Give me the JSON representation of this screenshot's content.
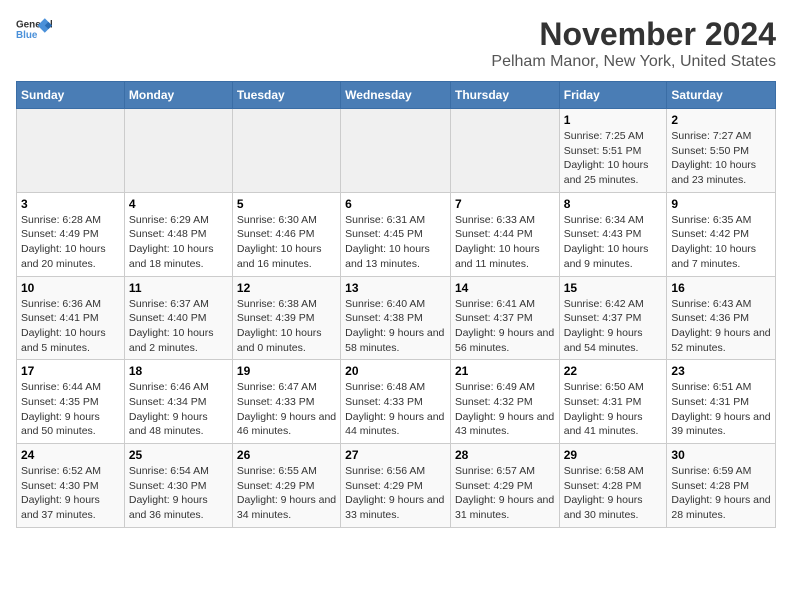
{
  "logo": {
    "line1": "General",
    "line2": "Blue"
  },
  "title": "November 2024",
  "subtitle": "Pelham Manor, New York, United States",
  "days_of_week": [
    "Sunday",
    "Monday",
    "Tuesday",
    "Wednesday",
    "Thursday",
    "Friday",
    "Saturday"
  ],
  "weeks": [
    [
      {
        "day": "",
        "info": ""
      },
      {
        "day": "",
        "info": ""
      },
      {
        "day": "",
        "info": ""
      },
      {
        "day": "",
        "info": ""
      },
      {
        "day": "",
        "info": ""
      },
      {
        "day": "1",
        "info": "Sunrise: 7:25 AM\nSunset: 5:51 PM\nDaylight: 10 hours and 25 minutes."
      },
      {
        "day": "2",
        "info": "Sunrise: 7:27 AM\nSunset: 5:50 PM\nDaylight: 10 hours and 23 minutes."
      }
    ],
    [
      {
        "day": "3",
        "info": "Sunrise: 6:28 AM\nSunset: 4:49 PM\nDaylight: 10 hours and 20 minutes."
      },
      {
        "day": "4",
        "info": "Sunrise: 6:29 AM\nSunset: 4:48 PM\nDaylight: 10 hours and 18 minutes."
      },
      {
        "day": "5",
        "info": "Sunrise: 6:30 AM\nSunset: 4:46 PM\nDaylight: 10 hours and 16 minutes."
      },
      {
        "day": "6",
        "info": "Sunrise: 6:31 AM\nSunset: 4:45 PM\nDaylight: 10 hours and 13 minutes."
      },
      {
        "day": "7",
        "info": "Sunrise: 6:33 AM\nSunset: 4:44 PM\nDaylight: 10 hours and 11 minutes."
      },
      {
        "day": "8",
        "info": "Sunrise: 6:34 AM\nSunset: 4:43 PM\nDaylight: 10 hours and 9 minutes."
      },
      {
        "day": "9",
        "info": "Sunrise: 6:35 AM\nSunset: 4:42 PM\nDaylight: 10 hours and 7 minutes."
      }
    ],
    [
      {
        "day": "10",
        "info": "Sunrise: 6:36 AM\nSunset: 4:41 PM\nDaylight: 10 hours and 5 minutes."
      },
      {
        "day": "11",
        "info": "Sunrise: 6:37 AM\nSunset: 4:40 PM\nDaylight: 10 hours and 2 minutes."
      },
      {
        "day": "12",
        "info": "Sunrise: 6:38 AM\nSunset: 4:39 PM\nDaylight: 10 hours and 0 minutes."
      },
      {
        "day": "13",
        "info": "Sunrise: 6:40 AM\nSunset: 4:38 PM\nDaylight: 9 hours and 58 minutes."
      },
      {
        "day": "14",
        "info": "Sunrise: 6:41 AM\nSunset: 4:37 PM\nDaylight: 9 hours and 56 minutes."
      },
      {
        "day": "15",
        "info": "Sunrise: 6:42 AM\nSunset: 4:37 PM\nDaylight: 9 hours and 54 minutes."
      },
      {
        "day": "16",
        "info": "Sunrise: 6:43 AM\nSunset: 4:36 PM\nDaylight: 9 hours and 52 minutes."
      }
    ],
    [
      {
        "day": "17",
        "info": "Sunrise: 6:44 AM\nSunset: 4:35 PM\nDaylight: 9 hours and 50 minutes."
      },
      {
        "day": "18",
        "info": "Sunrise: 6:46 AM\nSunset: 4:34 PM\nDaylight: 9 hours and 48 minutes."
      },
      {
        "day": "19",
        "info": "Sunrise: 6:47 AM\nSunset: 4:33 PM\nDaylight: 9 hours and 46 minutes."
      },
      {
        "day": "20",
        "info": "Sunrise: 6:48 AM\nSunset: 4:33 PM\nDaylight: 9 hours and 44 minutes."
      },
      {
        "day": "21",
        "info": "Sunrise: 6:49 AM\nSunset: 4:32 PM\nDaylight: 9 hours and 43 minutes."
      },
      {
        "day": "22",
        "info": "Sunrise: 6:50 AM\nSunset: 4:31 PM\nDaylight: 9 hours and 41 minutes."
      },
      {
        "day": "23",
        "info": "Sunrise: 6:51 AM\nSunset: 4:31 PM\nDaylight: 9 hours and 39 minutes."
      }
    ],
    [
      {
        "day": "24",
        "info": "Sunrise: 6:52 AM\nSunset: 4:30 PM\nDaylight: 9 hours and 37 minutes."
      },
      {
        "day": "25",
        "info": "Sunrise: 6:54 AM\nSunset: 4:30 PM\nDaylight: 9 hours and 36 minutes."
      },
      {
        "day": "26",
        "info": "Sunrise: 6:55 AM\nSunset: 4:29 PM\nDaylight: 9 hours and 34 minutes."
      },
      {
        "day": "27",
        "info": "Sunrise: 6:56 AM\nSunset: 4:29 PM\nDaylight: 9 hours and 33 minutes."
      },
      {
        "day": "28",
        "info": "Sunrise: 6:57 AM\nSunset: 4:29 PM\nDaylight: 9 hours and 31 minutes."
      },
      {
        "day": "29",
        "info": "Sunrise: 6:58 AM\nSunset: 4:28 PM\nDaylight: 9 hours and 30 minutes."
      },
      {
        "day": "30",
        "info": "Sunrise: 6:59 AM\nSunset: 4:28 PM\nDaylight: 9 hours and 28 minutes."
      }
    ]
  ]
}
